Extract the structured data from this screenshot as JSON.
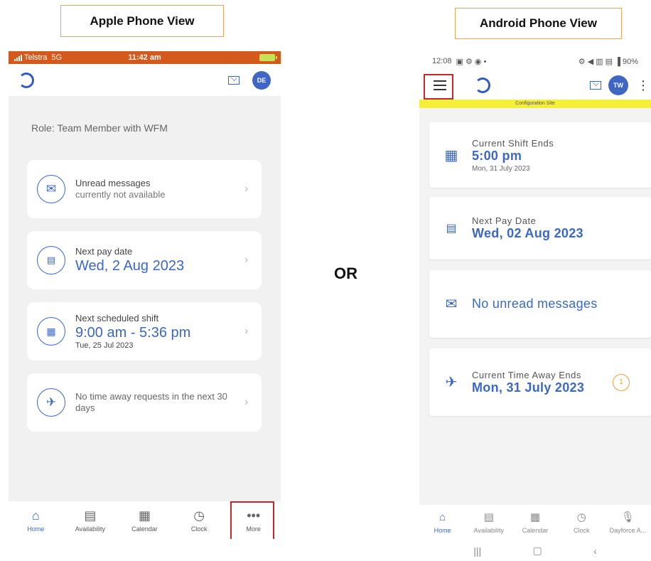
{
  "labels": {
    "apple": "Apple Phone View",
    "android": "Android Phone View",
    "or": "OR"
  },
  "apple": {
    "status": {
      "carrier": "Telstra",
      "network": "5G",
      "time": "11:42 am"
    },
    "header": {
      "avatar_initials": "DE"
    },
    "role": "Role: Team Member with WFM",
    "cards": [
      {
        "icon": "envelope-icon",
        "title": "Unread messages",
        "subtitle": "currently not available"
      },
      {
        "icon": "pay-icon",
        "title": "Next pay date",
        "value": "Wed, 2 Aug 2023"
      },
      {
        "icon": "calendar-icon",
        "title": "Next scheduled shift",
        "value": "9:00 am - 5:36 pm",
        "date": "Tue, 25 Jul 2023"
      },
      {
        "icon": "plane-icon",
        "title": "No time away requests in the next 30 days"
      }
    ],
    "tabs": [
      {
        "label": "Home",
        "icon": "home-icon",
        "active": true
      },
      {
        "label": "Availability",
        "icon": "availability-icon",
        "active": false
      },
      {
        "label": "Calendar",
        "icon": "calendar-icon",
        "active": false
      },
      {
        "label": "Clock",
        "icon": "clock-icon",
        "active": false
      },
      {
        "label": "More",
        "icon": "more-icon",
        "active": false
      }
    ]
  },
  "android": {
    "status": {
      "time": "12:08",
      "right": "90%"
    },
    "header": {
      "avatar_initials": "TW"
    },
    "banner": "Configuration Site",
    "cards": [
      {
        "icon": "calendar-icon",
        "label": "Current Shift Ends",
        "value": "5:00 pm",
        "date": "Mon, 31 July 2023"
      },
      {
        "icon": "pay-icon",
        "label": "Next Pay Date",
        "value": "Wed, 02 Aug 2023"
      },
      {
        "icon": "envelope-icon",
        "value": "No unread messages"
      },
      {
        "icon": "plane-icon",
        "label": "Current Time Away Ends",
        "value": "Mon, 31 July 2023",
        "badge": "1"
      }
    ],
    "tabs": [
      {
        "label": "Home",
        "icon": "home-icon",
        "active": true
      },
      {
        "label": "Availability",
        "icon": "availability-icon",
        "active": false
      },
      {
        "label": "Calendar",
        "icon": "calendar-icon",
        "active": false
      },
      {
        "label": "Clock",
        "icon": "clock-icon",
        "active": false
      },
      {
        "label": "Dayforce A...",
        "icon": "microphone-icon",
        "active": false
      }
    ]
  },
  "colors": {
    "brand": "#3b68c6",
    "ios_status": "#d4591c",
    "highlight": "#c62828",
    "banner": "#f4ef3b"
  }
}
